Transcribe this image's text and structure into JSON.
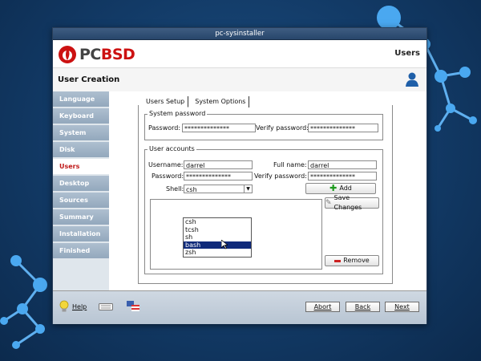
{
  "window": {
    "title": "pc-sysinstaller"
  },
  "header": {
    "logo_text_pc": "PC",
    "logo_text_bsd": "BSD",
    "page_name": "Users",
    "section_title": "User Creation"
  },
  "sidebar": {
    "items": [
      {
        "label": "Language"
      },
      {
        "label": "Keyboard"
      },
      {
        "label": "System"
      },
      {
        "label": "Disk"
      },
      {
        "label": "Users",
        "active": true
      },
      {
        "label": "Desktop"
      },
      {
        "label": "Sources"
      },
      {
        "label": "Summary"
      },
      {
        "label": "Installation"
      },
      {
        "label": "Finished"
      }
    ]
  },
  "tabs": [
    {
      "label": "Users Setup",
      "active": true
    },
    {
      "label": "System Options"
    }
  ],
  "system_password": {
    "legend": "System password",
    "password_label": "Password:",
    "password_value": "**************",
    "verify_label": "Verify password:",
    "verify_value": "**************"
  },
  "user_accounts": {
    "legend": "User accounts",
    "username_label": "Username:",
    "username_value": "darrel",
    "fullname_label": "Full name:",
    "fullname_value": "darrel",
    "password_label": "Password:",
    "password_value": "**************",
    "verify_label": "Verify password:",
    "verify_value": "**************",
    "shell_label": "Shell:",
    "shell_value": "csh",
    "shell_options": [
      "csh",
      "tcsh",
      "sh",
      "bash",
      "zsh"
    ],
    "shell_highlighted": "bash",
    "add_label": "Add",
    "save_label": "Save Changes",
    "remove_label": "Remove"
  },
  "footer": {
    "help_label": "Help",
    "abort_label": "Abort",
    "back_label": "Back",
    "next_label": "Next"
  },
  "colors": {
    "accent_red": "#cc1111",
    "sidebar_blue": "#9fb3c7",
    "selection": "#0f2a7a"
  }
}
